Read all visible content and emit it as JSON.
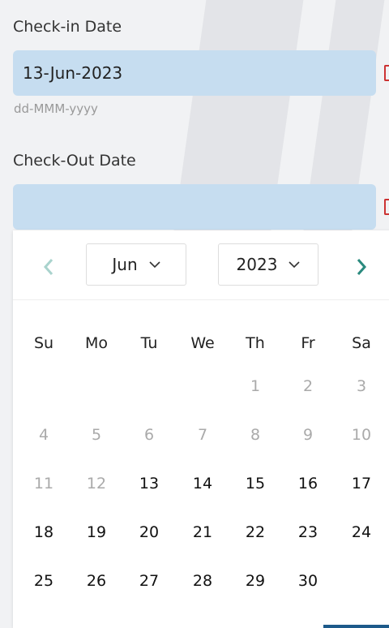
{
  "checkin": {
    "label": "Check-in Date",
    "value": "13-Jun-2023",
    "hint": "dd-MMM-yyyy"
  },
  "checkout": {
    "label": "Check-Out Date",
    "value": ""
  },
  "calendar": {
    "month": "Jun",
    "year": "2023",
    "prev_icon": "chevron-left-icon",
    "next_icon": "chevron-right-icon",
    "weekdays": [
      "Su",
      "Mo",
      "Tu",
      "We",
      "Th",
      "Fr",
      "Sa"
    ],
    "weeks": [
      [
        null,
        null,
        null,
        null,
        {
          "day": "1",
          "enabled": false
        },
        {
          "day": "2",
          "enabled": false
        },
        {
          "day": "3",
          "enabled": false
        }
      ],
      [
        {
          "day": "4",
          "enabled": false
        },
        {
          "day": "5",
          "enabled": false
        },
        {
          "day": "6",
          "enabled": false
        },
        {
          "day": "7",
          "enabled": false
        },
        {
          "day": "8",
          "enabled": false
        },
        {
          "day": "9",
          "enabled": false
        },
        {
          "day": "10",
          "enabled": false
        }
      ],
      [
        {
          "day": "11",
          "enabled": false
        },
        {
          "day": "12",
          "enabled": false
        },
        {
          "day": "13",
          "enabled": true
        },
        {
          "day": "14",
          "enabled": true
        },
        {
          "day": "15",
          "enabled": true
        },
        {
          "day": "16",
          "enabled": true
        },
        {
          "day": "17",
          "enabled": true
        }
      ],
      [
        {
          "day": "18",
          "enabled": true
        },
        {
          "day": "19",
          "enabled": true
        },
        {
          "day": "20",
          "enabled": true
        },
        {
          "day": "21",
          "enabled": true
        },
        {
          "day": "22",
          "enabled": true
        },
        {
          "day": "23",
          "enabled": true
        },
        {
          "day": "24",
          "enabled": true
        }
      ],
      [
        {
          "day": "25",
          "enabled": true
        },
        {
          "day": "26",
          "enabled": true
        },
        {
          "day": "27",
          "enabled": true
        },
        {
          "day": "28",
          "enabled": true
        },
        {
          "day": "29",
          "enabled": true
        },
        {
          "day": "30",
          "enabled": true
        },
        null
      ]
    ]
  },
  "colors": {
    "field_bg": "#c6ddf0",
    "accent": "#2a8a7e",
    "disabled_day": "#aaaaaa"
  }
}
